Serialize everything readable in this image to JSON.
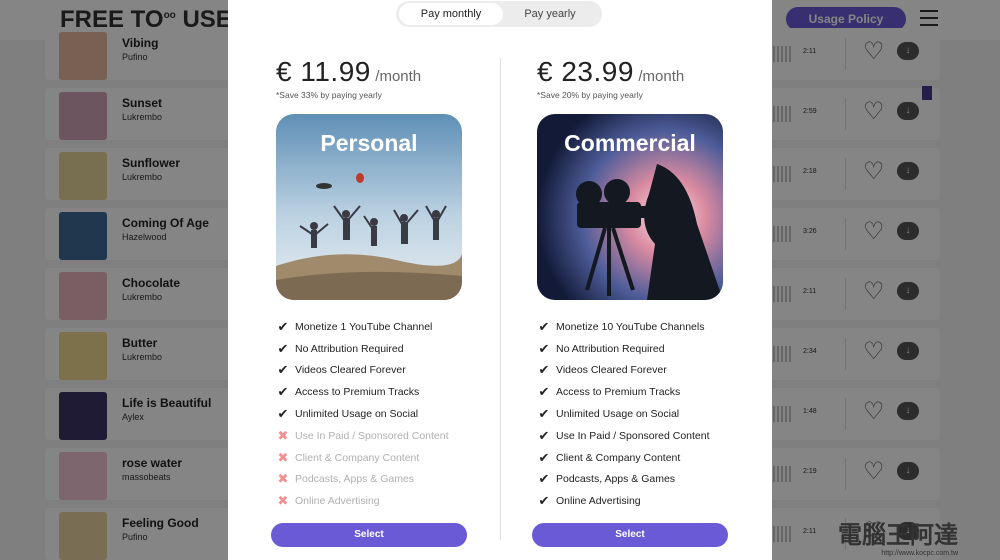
{
  "header": {
    "logo": "FREE TO",
    "logo_sup": "oo",
    "logo_tail": " USE",
    "usage_policy": "Usage Policy"
  },
  "tracks": [
    {
      "title": "Vibing",
      "artist": "Pufino",
      "duration": "2:11"
    },
    {
      "title": "Sunset",
      "artist": "Lukrembo",
      "duration": "2:59"
    },
    {
      "title": "Sunflower",
      "artist": "Lukrembo",
      "duration": "2:18"
    },
    {
      "title": "Coming Of Age",
      "artist": "Hazelwood",
      "duration": "3:26"
    },
    {
      "title": "Chocolate",
      "artist": "Lukrembo",
      "duration": "2:11"
    },
    {
      "title": "Butter",
      "artist": "Lukrembo",
      "duration": "2:34"
    },
    {
      "title": "Life is Beautiful",
      "artist": "Aylex",
      "duration": "1:48"
    },
    {
      "title": "rose water",
      "artist": "massobeats",
      "duration": "2:19"
    },
    {
      "title": "Feeling Good",
      "artist": "Pufino",
      "duration": "2:11"
    }
  ],
  "billing": {
    "monthly": "Pay monthly",
    "yearly": "Pay yearly",
    "selected": "Pay monthly"
  },
  "plans": {
    "personal": {
      "price": "€ 11.99",
      "period": "/month",
      "save_note": "*Save 33% by paying yearly",
      "label": "Personal",
      "features": [
        {
          "text": "Monetize 1 YouTube Channel",
          "included": true
        },
        {
          "text": "No Attribution Required",
          "included": true
        },
        {
          "text": "Videos Cleared Forever",
          "included": true
        },
        {
          "text": "Access to Premium Tracks",
          "included": true
        },
        {
          "text": "Unlimited Usage on Social",
          "included": true
        },
        {
          "text": "Use In Paid / Sponsored Content",
          "included": false
        },
        {
          "text": "Client & Company Content",
          "included": false
        },
        {
          "text": "Podcasts, Apps & Games",
          "included": false
        },
        {
          "text": "Online Advertising",
          "included": false
        }
      ],
      "button": "Select"
    },
    "commercial": {
      "price": "€ 23.99",
      "period": "/month",
      "save_note": "*Save 20% by paying yearly",
      "label": "Commercial",
      "features": [
        {
          "text": "Monetize 10 YouTube Channels",
          "included": true
        },
        {
          "text": "No Attribution Required",
          "included": true
        },
        {
          "text": "Videos Cleared Forever",
          "included": true
        },
        {
          "text": "Access to Premium Tracks",
          "included": true
        },
        {
          "text": "Unlimited Usage on Social",
          "included": true
        },
        {
          "text": "Use In Paid / Sponsored Content",
          "included": true
        },
        {
          "text": "Client & Company Content",
          "included": true
        },
        {
          "text": "Podcasts, Apps & Games",
          "included": true
        },
        {
          "text": "Online Advertising",
          "included": true
        }
      ],
      "button": "Select"
    }
  },
  "marks": {
    "check": "✔",
    "cross": "✖"
  },
  "watermark": {
    "text": "電腦王阿達",
    "url": "http://www.kocpc.com.tw"
  },
  "colors": {
    "accent": "#6b5ad6",
    "excluded": "#ee9191"
  }
}
